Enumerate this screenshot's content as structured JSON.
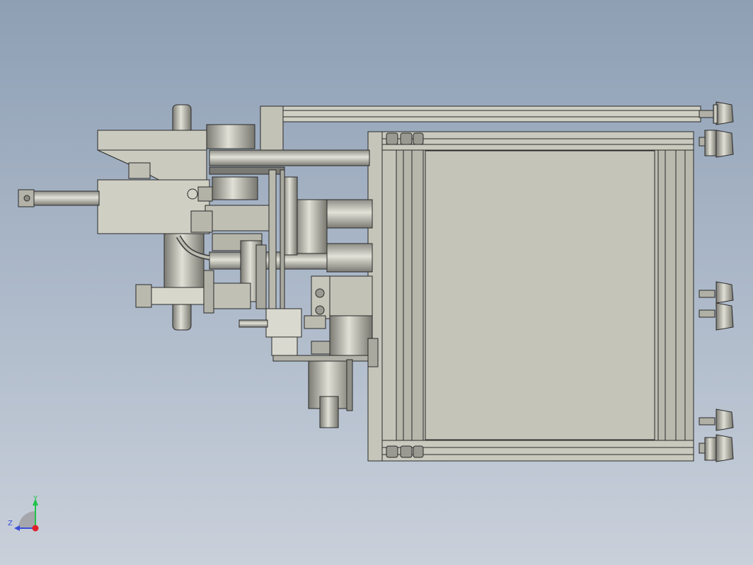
{
  "viewport": {
    "background_top": "#8e9fb4",
    "background_bottom": "#c9d0da"
  },
  "model": {
    "kind": "cad-assembly-side-view",
    "part_fill": "#c8c8bc",
    "part_dark": "#6f6f69",
    "edge_color": "#2a2a2a"
  },
  "triad": {
    "y_label": "Y",
    "z_label": "Z",
    "y_color": "#22c24a",
    "z_color": "#3a4fd8",
    "origin_color": "#e0202a"
  }
}
